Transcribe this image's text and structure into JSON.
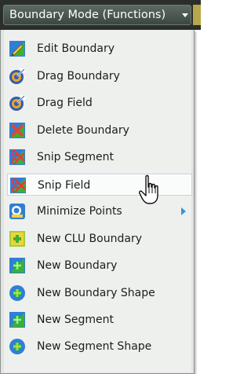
{
  "dropdown": {
    "label": "Boundary Mode (Functions)",
    "caret_icon": "triangle-down"
  },
  "menu": {
    "items": [
      {
        "label": "Edit Boundary",
        "icon": "edit-boundary-icon"
      },
      {
        "label": "Drag Boundary",
        "icon": "drag-target-icon"
      },
      {
        "label": "Drag Field",
        "icon": "drag-target-icon"
      },
      {
        "label": "Delete Boundary",
        "icon": "delete-boundary-icon"
      },
      {
        "label": "Snip Segment",
        "icon": "scissors-icon"
      },
      {
        "label": "Snip Field",
        "icon": "scissors-icon",
        "highlighted": true
      },
      {
        "label": "Minimize Points",
        "icon": "minimize-points-icon",
        "has_submenu": true
      },
      {
        "label": "New CLU Boundary",
        "icon": "new-clu-icon"
      },
      {
        "label": "New Boundary",
        "icon": "new-boundary-icon"
      },
      {
        "label": "New Boundary Shape",
        "icon": "new-shape-icon"
      },
      {
        "label": "New Segment",
        "icon": "new-boundary-icon"
      },
      {
        "label": "New Segment Shape",
        "icon": "new-shape-icon"
      }
    ]
  },
  "cursor": {
    "icon": "hand-pointer-icon"
  },
  "colors": {
    "menu_background": "#e1e4e1",
    "highlight": "#fafcfb",
    "submenu_arrow": "#3b8fe0",
    "green_icon": "#3fae34",
    "blue_icon": "#2f7fd6",
    "red_icon": "#d64a3a"
  }
}
